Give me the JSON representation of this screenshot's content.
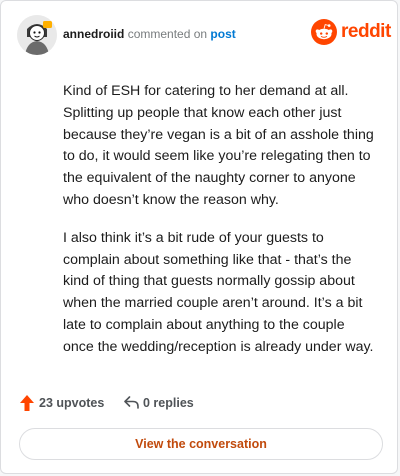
{
  "header": {
    "username": "annedroiid",
    "action_text": "commented on",
    "post_link": "post",
    "brand_name": "reddit"
  },
  "comment": {
    "paragraphs": [
      "Kind of ESH for catering to her demand at all. Splitting up people that know each other just because they’re vegan is a bit of an asshole thing to do, it would seem like you’re relegating then to the equivalent of the naughty corner to anyone who doesn’t know the reason why.",
      "I also think it’s a bit rude of your guests to complain about something like that - that’s the kind of thing that guests normally gossip about when the married couple aren’t around. It’s a bit late to complain about anything to the couple once the wedding/reception is already under way."
    ]
  },
  "stats": {
    "upvotes": "23 upvotes",
    "replies": "0 replies"
  },
  "cta": {
    "label": "View the conversation"
  },
  "colors": {
    "brand": "#ff4500",
    "link": "#0079d3",
    "upvote": "#ff4500",
    "cta_text": "#c14a0c"
  },
  "icons": [
    "avatar",
    "reddit-logo-icon",
    "upvote-arrow-icon",
    "reply-icon"
  ]
}
